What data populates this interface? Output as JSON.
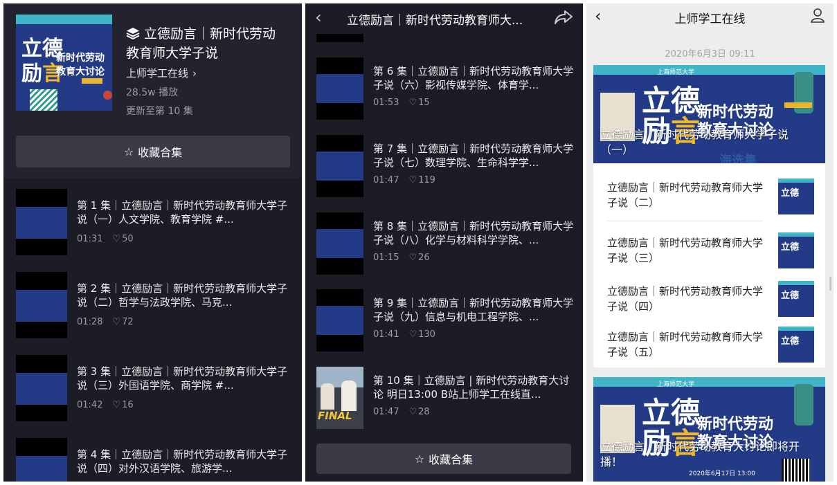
{
  "colors": {
    "dark_bg": "#1b1c25",
    "header_bg": "#22232e",
    "button_bg": "#3a3b46",
    "cover_blue": "#233b86",
    "cover_teal": "#3fb5c7",
    "cover_gold": "#e9b52f",
    "light_bg": "#ededed"
  },
  "cover": {
    "line1": "立德",
    "line2a": "励",
    "line2b": "言",
    "sub1": "新时代劳动",
    "sub2": "教育大讨论",
    "school": "上海师范大学",
    "audition": "海选集",
    "date": "2020年6月17日 13:00",
    "final": "FINAL"
  },
  "collection": {
    "title": "立德励言｜新时代劳动教育师大学子说",
    "author": "上师学工在线",
    "plays": "28.5w 播放",
    "updated": "更新至第 10 集",
    "fav_label": "收藏合集",
    "icons": {
      "stack": "stack-icon",
      "chevron": "chevron-right-icon",
      "star": "star-icon",
      "heart": "heart-icon"
    }
  },
  "episodes_p1": [
    {
      "title": "第 1 集｜立德励言｜新时代劳动教育师大学子说（一）人文学院、教育学院 #...",
      "duration": "01:31",
      "likes": "50"
    },
    {
      "title": "第 2 集｜立德励言｜新时代劳动教育师大学子说（二）哲学与法政学院、马克...",
      "duration": "01:28",
      "likes": "72"
    },
    {
      "title": "第 3 集｜立德励言｜新时代劳动教育师大学子说（三）外国语学院、商学院 #...",
      "duration": "01:42",
      "likes": "16"
    },
    {
      "title": "第 4 集｜立德励言｜新时代劳动教育师大学子说（四）对外汉语学院、旅游学...",
      "duration": "",
      "likes": ""
    }
  ],
  "panel2": {
    "nav_title": "立德励言｜新时代劳动教育师大...",
    "fav_label": "收藏合集"
  },
  "episodes_p2": [
    {
      "title": "第 6 集｜立德励言｜新时代劳动教育师大学子说（六）影视传媒学院、体育学...",
      "duration": "01:53",
      "likes": "15"
    },
    {
      "title": "第 7 集｜立德励言｜新时代劳动教育师大学子说（七）数理学院、生命科学学...",
      "duration": "01:47",
      "likes": "119"
    },
    {
      "title": "第 8 集｜立德励言｜新时代劳动教育师大学子说（八）化学与材料科学学院、...",
      "duration": "01:15",
      "likes": "26"
    },
    {
      "title": "第 9 集｜立德励言｜新时代劳动教育师大学子说（九）信息与机电工程学院、...",
      "duration": "01:41",
      "likes": "130"
    },
    {
      "title": "第 10 集｜立德励言 | 新时代劳动教育大讨论 明日13:00 B站上师学工在线直...",
      "duration": "01:47",
      "likes": "28"
    }
  ],
  "panel3": {
    "nav_title": "上师学工在线",
    "timestamp": "2020年6月3日 09:11",
    "card1_caption": "立德励言｜新时代劳动教育师大学子说（一）",
    "articles": [
      "立德励言｜新时代劳动教育师大学子说（二）",
      "立德励言｜新时代劳动教育师大学子说（三）",
      "立德励言｜新时代劳动教育师大学子说（四）",
      "立德励言｜新时代劳动教育师大学子说（五）"
    ],
    "card2_caption": "立德励言｜新时代劳动教育大讨论即将开播！"
  }
}
